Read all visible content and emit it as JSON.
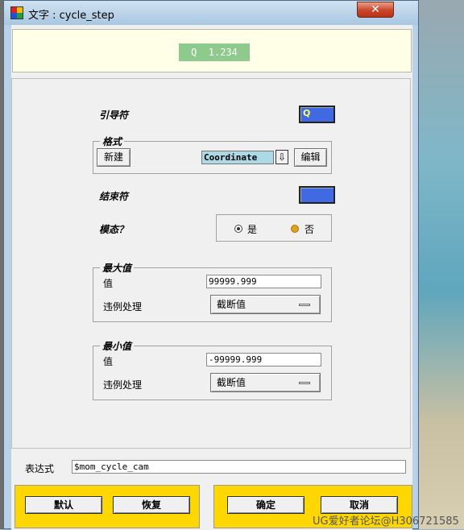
{
  "window": {
    "title": "文字 : cycle_step",
    "close_label": "✕"
  },
  "preview": {
    "text": "Q  1.234"
  },
  "leader": {
    "label": "引导符",
    "value": "Q"
  },
  "format": {
    "group_title": "格式",
    "new_button": "新建",
    "value": "Coordinate",
    "dropdown_glyph": "⇩",
    "edit_button": "编辑"
  },
  "trailer": {
    "label": "结束符",
    "value": ""
  },
  "modal": {
    "label": "模态？",
    "yes": "是",
    "no": "否",
    "selected": "是"
  },
  "max_value": {
    "group_title": "最大值",
    "value_label": "值",
    "value": "99999.999",
    "violation_label": "违例处理",
    "violation_option": "截断值"
  },
  "min_value": {
    "group_title": "最小值",
    "value_label": "值",
    "value": "-99999.999",
    "violation_label": "违例处理",
    "violation_option": "截断值"
  },
  "expression": {
    "label": "表达式",
    "value": "$mom_cycle_cam"
  },
  "buttons": {
    "default": "默认",
    "restore": "恢复",
    "ok": "确定",
    "cancel": "取消"
  },
  "watermark": "UG爱好者论坛@H306721585",
  "colors": {
    "field_blue": "#4169e1",
    "button_bar": "#ffd700",
    "preview_chip": "#8ec98e",
    "combo_bg": "#add8e6"
  }
}
